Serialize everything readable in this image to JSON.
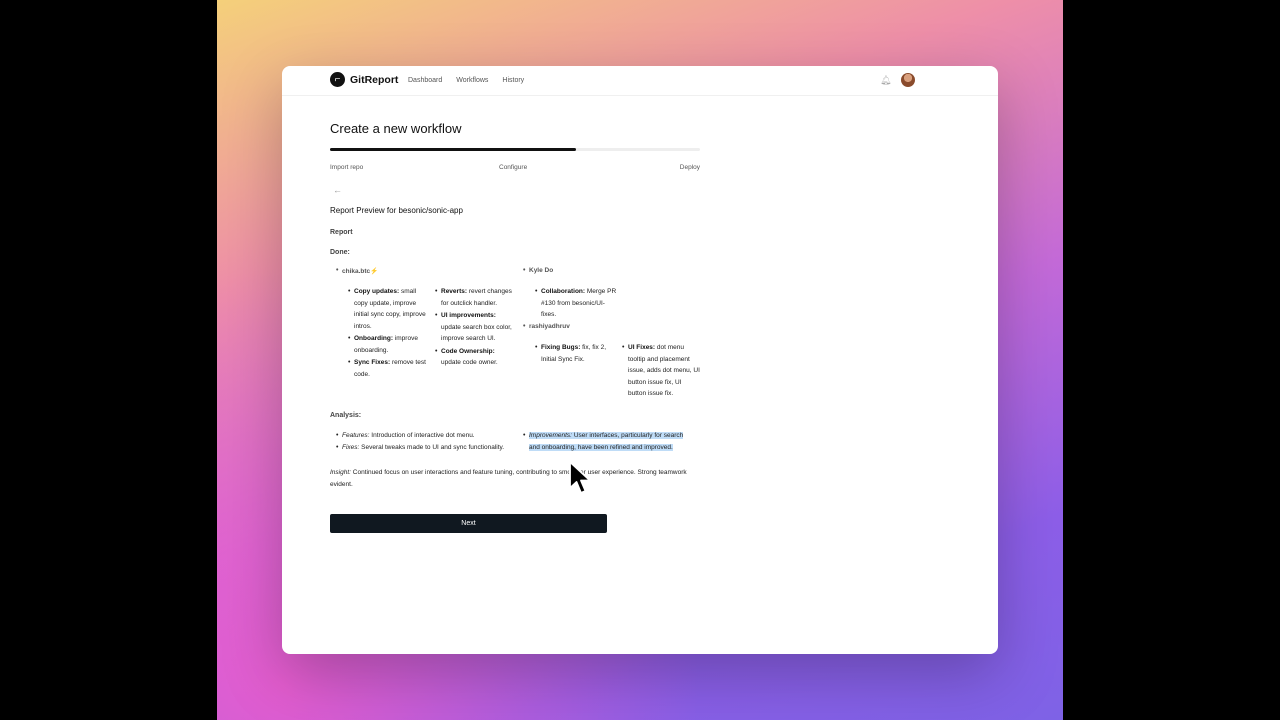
{
  "app": {
    "name": "GitReport"
  },
  "nav": {
    "links": [
      "Dashboard",
      "Workflows",
      "History"
    ]
  },
  "page": {
    "title": "Create a new workflow"
  },
  "progress": {
    "fraction": 0.665
  },
  "steps": [
    "Import repo",
    "Configure",
    "Deploy"
  ],
  "preview": {
    "title": "Report Preview for besonic/sonic-app",
    "report_label": "Report",
    "done_label": "Done:"
  },
  "contributors": {
    "chika": {
      "name": "chika.btc⚡",
      "col1": [
        {
          "label": "Copy updates:",
          "text": "small copy update, improve initial sync copy, improve intros."
        },
        {
          "label": "Onboarding:",
          "text": "improve onboarding."
        },
        {
          "label": "Sync Fixes:",
          "text": "remove test code."
        }
      ],
      "col2": [
        {
          "label": "Reverts:",
          "text": "revert changes for outclick handler."
        },
        {
          "label": "UI improvements:",
          "text": "update search box color, improve search UI."
        },
        {
          "label": "Code Ownership:",
          "text": "update code owner."
        }
      ]
    },
    "kyle": {
      "name": "Kyle Do",
      "items": [
        {
          "label": "Collaboration:",
          "text": "Merge PR #130 from besonic/UI-fixes."
        }
      ]
    },
    "rashi": {
      "name": "rashiyadhruv",
      "col1": [
        {
          "label": "Fixing Bugs:",
          "text": "fix, fix 2, Initial Sync Fix."
        }
      ],
      "col2": [
        {
          "label": "UI Fixes:",
          "text": "dot menu tooltip and placement issue, adds dot menu, UI button issue fix, UI button issue fix."
        }
      ]
    }
  },
  "analysis": {
    "label": "Analysis:",
    "features_label": "Features:",
    "features_text": "Introduction of interactive dot menu.",
    "fixes_label": "Fixes:",
    "fixes_text": "Several tweaks made to UI and sync functionality.",
    "improvements_label": "Improvements:",
    "improvements_text": "User interfaces, particularly for search and onboarding, have been refined and improved.",
    "insight_label": "Insight:",
    "insight_text": "Continued focus on user interactions and feature tuning, contributing to smoother user experience. Strong teamwork evident."
  },
  "actions": {
    "next_label": "Next"
  },
  "icons": {
    "logo": "gitreport-logo-icon",
    "back": "arrow-left-icon",
    "bell": "bell-icon",
    "cursor": "mouse-pointer-icon"
  }
}
